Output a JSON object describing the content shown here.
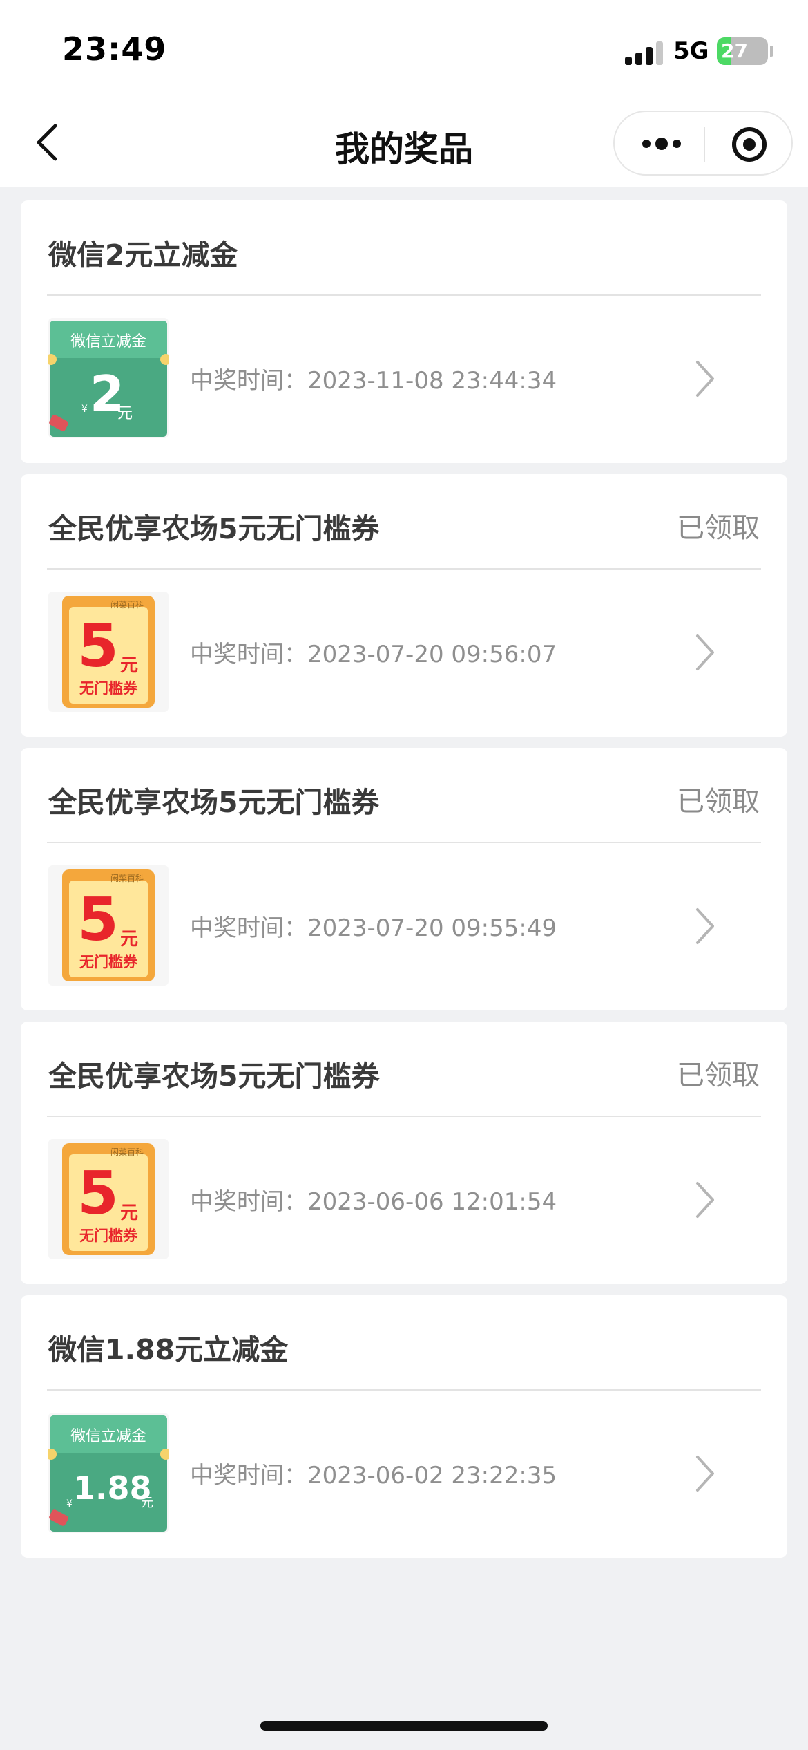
{
  "status_bar": {
    "time": "23:49",
    "network": "5G",
    "battery": "27",
    "battery_level": 0.27
  },
  "nav": {
    "title": "我的奖品"
  },
  "prize_time_label": "中奖时间：",
  "prizes": [
    {
      "title": "微信2元立减金",
      "status": "",
      "time": "2023-11-08 23:44:34",
      "thumb": {
        "type": "wechat",
        "header": "微信立减金",
        "currency": "¥",
        "amount": "2",
        "unit": "元"
      }
    },
    {
      "title": "全民优享农场5元无门槛券",
      "status": "已领取",
      "time": "2023-07-20 09:56:07",
      "thumb": {
        "type": "coupon",
        "brand": "闲菜百科",
        "amount": "5",
        "unit": "元",
        "label": "无门槛券"
      }
    },
    {
      "title": "全民优享农场5元无门槛券",
      "status": "已领取",
      "time": "2023-07-20 09:55:49",
      "thumb": {
        "type": "coupon",
        "brand": "闲菜百科",
        "amount": "5",
        "unit": "元",
        "label": "无门槛券"
      }
    },
    {
      "title": "全民优享农场5元无门槛券",
      "status": "已领取",
      "time": "2023-06-06 12:01:54",
      "thumb": {
        "type": "coupon",
        "brand": "闲菜百科",
        "amount": "5",
        "unit": "元",
        "label": "无门槛券"
      }
    },
    {
      "title": "微信1.88元立减金",
      "status": "",
      "time": "2023-06-02 23:22:35",
      "thumb": {
        "type": "wechat",
        "header": "微信立减金",
        "currency": "¥",
        "amount": "1.88",
        "unit": "元"
      }
    }
  ],
  "icons": {
    "back": "chevron-left-icon",
    "more": "more-dots-icon",
    "close": "target-circle-icon",
    "row": "chevron-right-icon"
  },
  "colors": {
    "wechat_green": "#4aa982",
    "coupon_orange": "#f4a73c",
    "coupon_red": "#e8252b",
    "battery_green": "#4cd964"
  }
}
